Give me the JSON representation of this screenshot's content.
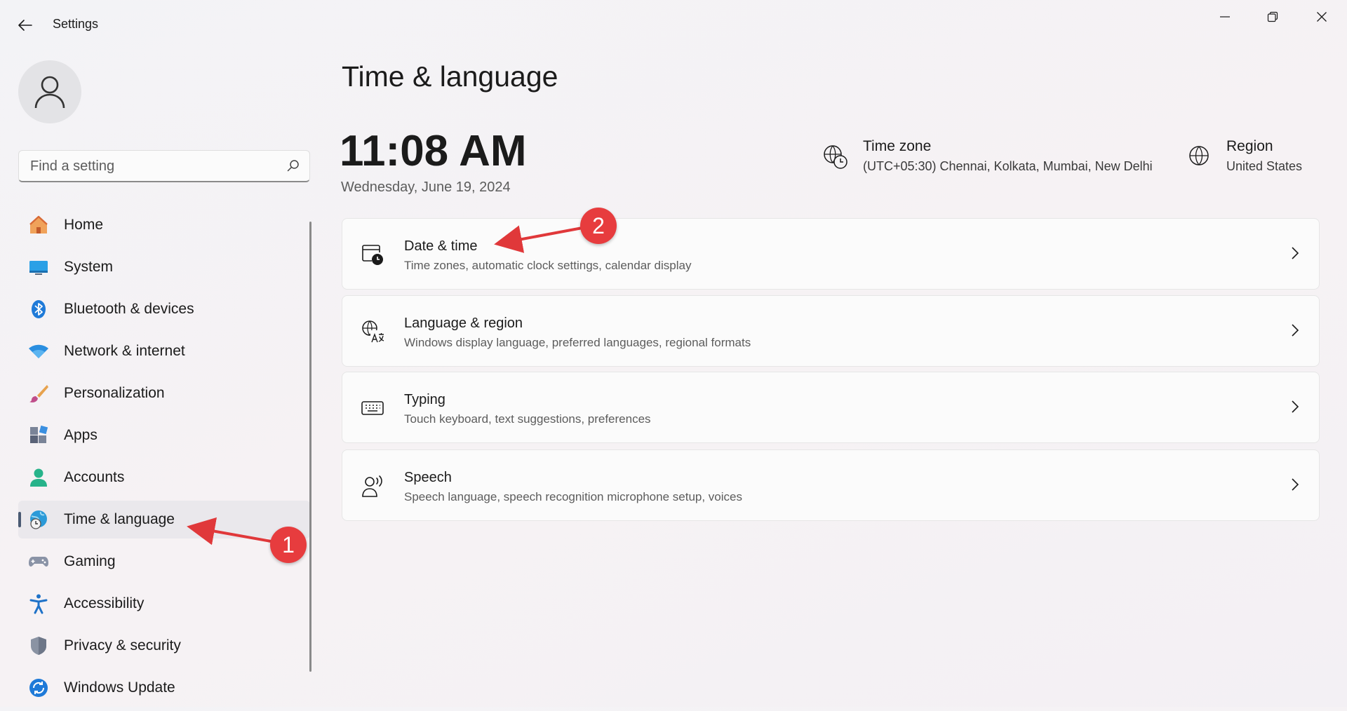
{
  "app": {
    "title": "Settings"
  },
  "search": {
    "placeholder": "Find a setting"
  },
  "sidebar": {
    "items": [
      {
        "label": "Home",
        "icon": "home-icon"
      },
      {
        "label": "System",
        "icon": "system-icon"
      },
      {
        "label": "Bluetooth & devices",
        "icon": "bluetooth-icon"
      },
      {
        "label": "Network & internet",
        "icon": "wifi-icon"
      },
      {
        "label": "Personalization",
        "icon": "brush-icon"
      },
      {
        "label": "Apps",
        "icon": "apps-icon"
      },
      {
        "label": "Accounts",
        "icon": "accounts-icon"
      },
      {
        "label": "Time & language",
        "icon": "globe-clock-icon",
        "active": true
      },
      {
        "label": "Gaming",
        "icon": "gamepad-icon"
      },
      {
        "label": "Accessibility",
        "icon": "accessibility-icon"
      },
      {
        "label": "Privacy & security",
        "icon": "shield-icon"
      },
      {
        "label": "Windows Update",
        "icon": "update-icon"
      }
    ]
  },
  "main": {
    "title": "Time & language",
    "time": "11:08 AM",
    "date": "Wednesday, June 19, 2024",
    "timezone": {
      "title": "Time zone",
      "value": "(UTC+05:30) Chennai, Kolkata, Mumbai, New Delhi",
      "icon": "timezone-icon"
    },
    "region": {
      "title": "Region",
      "value": "United States",
      "icon": "globe-icon"
    },
    "cards": [
      {
        "title": "Date & time",
        "desc": "Time zones, automatic clock settings, calendar display",
        "icon": "calendar-clock-icon"
      },
      {
        "title": "Language & region",
        "desc": "Windows display language, preferred languages, regional formats",
        "icon": "language-icon"
      },
      {
        "title": "Typing",
        "desc": "Touch keyboard, text suggestions, preferences",
        "icon": "keyboard-icon"
      },
      {
        "title": "Speech",
        "desc": "Speech language, speech recognition microphone setup, voices",
        "icon": "speech-icon"
      }
    ]
  },
  "annotations": {
    "badge1": "1",
    "badge2": "2",
    "color": "#e73c3e"
  },
  "colors": {
    "accent": "#0067c0",
    "background": "#f3f3f6",
    "card": "#fbfbfb"
  }
}
